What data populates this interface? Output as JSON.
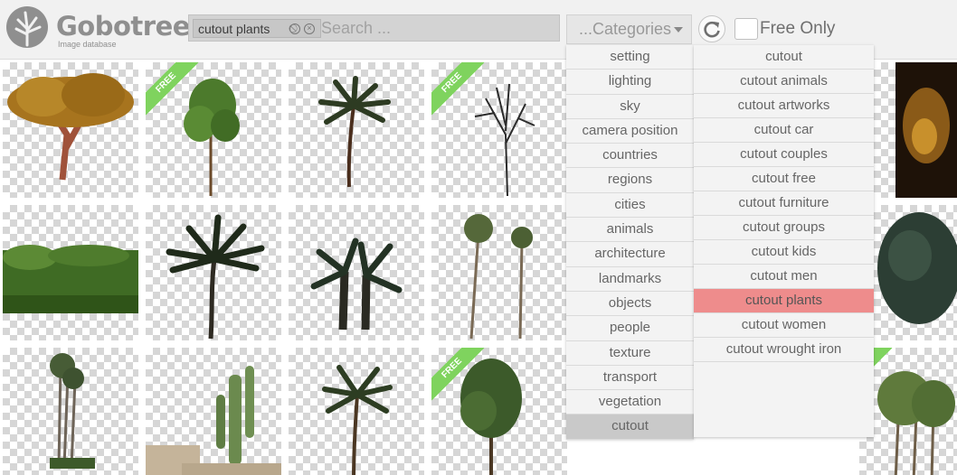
{
  "header": {
    "logo_text": "Gobotree",
    "logo_sub": "Image database",
    "tag_label": "cutout plants",
    "search_placeholder": "Search ...",
    "categories_label": "...Categories",
    "free_only_label": "Free Only"
  },
  "ribbon_label": "FREE",
  "categories": [
    "setting",
    "lighting",
    "sky",
    "camera position",
    "countries",
    "regions",
    "cities",
    "animals",
    "architecture",
    "landmarks",
    "objects",
    "people",
    "texture",
    "transport",
    "vegetation",
    "cutout"
  ],
  "active_category": "cutout",
  "subcategories": [
    "cutout",
    "cutout animals",
    "cutout artworks",
    "cutout car",
    "cutout couples",
    "cutout free",
    "cutout furniture",
    "cutout groups",
    "cutout kids",
    "cutout men",
    "cutout plants",
    "cutout women",
    "cutout wrought iron"
  ],
  "highlighted_subcategory": "cutout plants",
  "colors": {
    "ribbon": "#7fd35e",
    "highlight": "#ee8c8c",
    "header_bg": "#f1f1f1"
  },
  "tiles": [
    {
      "kind": "broad-tree",
      "free": false
    },
    {
      "kind": "leafy-tree",
      "free": true
    },
    {
      "kind": "palm",
      "free": false
    },
    {
      "kind": "bare-tree",
      "free": true
    },
    {
      "kind": "lit-tree",
      "free": false
    },
    {
      "kind": "banana-field",
      "free": false
    },
    {
      "kind": "palm",
      "free": false
    },
    {
      "kind": "double-palm",
      "free": false
    },
    {
      "kind": "tall-palms",
      "free": false
    },
    {
      "kind": "fan-palm",
      "free": false
    },
    {
      "kind": "palm-row",
      "free": false
    },
    {
      "kind": "cactus",
      "free": false
    },
    {
      "kind": "palm",
      "free": false
    },
    {
      "kind": "leafy-tree",
      "free": true
    },
    {
      "kind": "slim-trees",
      "free": true
    }
  ]
}
